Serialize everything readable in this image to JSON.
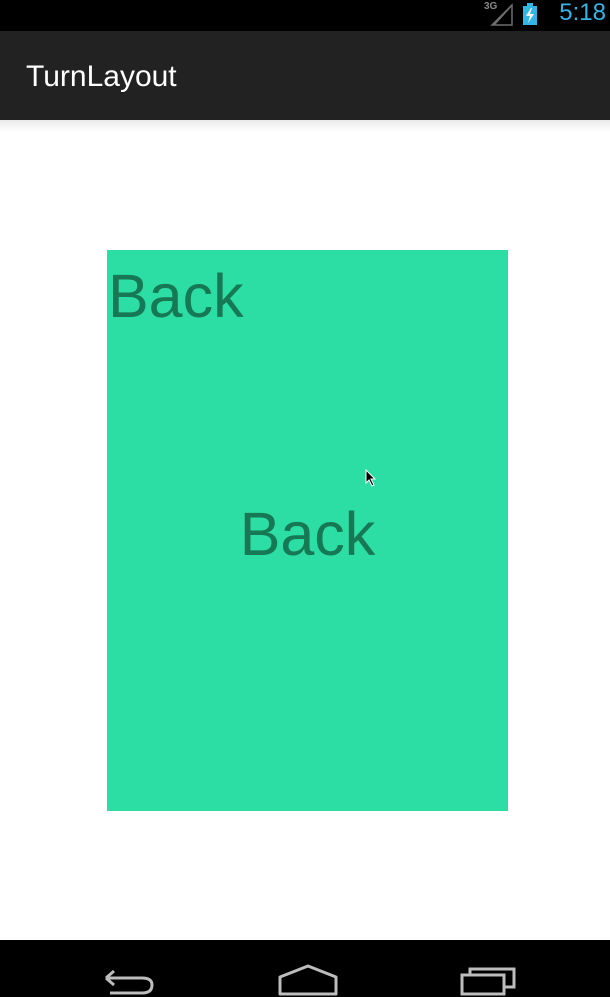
{
  "status_bar": {
    "network_label": "3G",
    "time": "5:18",
    "icons": [
      "signal-icon",
      "battery-charging-icon"
    ]
  },
  "action_bar": {
    "title": "TurnLayout"
  },
  "card": {
    "corner_label": "Back",
    "center_label": "Back",
    "color": "#2cdea3",
    "text_color": "#167855"
  },
  "nav_bar": {
    "icons": [
      "back-icon",
      "home-icon",
      "recent-apps-icon"
    ]
  },
  "colors": {
    "clock": "#33b5e5",
    "action_bar": "#222222"
  }
}
